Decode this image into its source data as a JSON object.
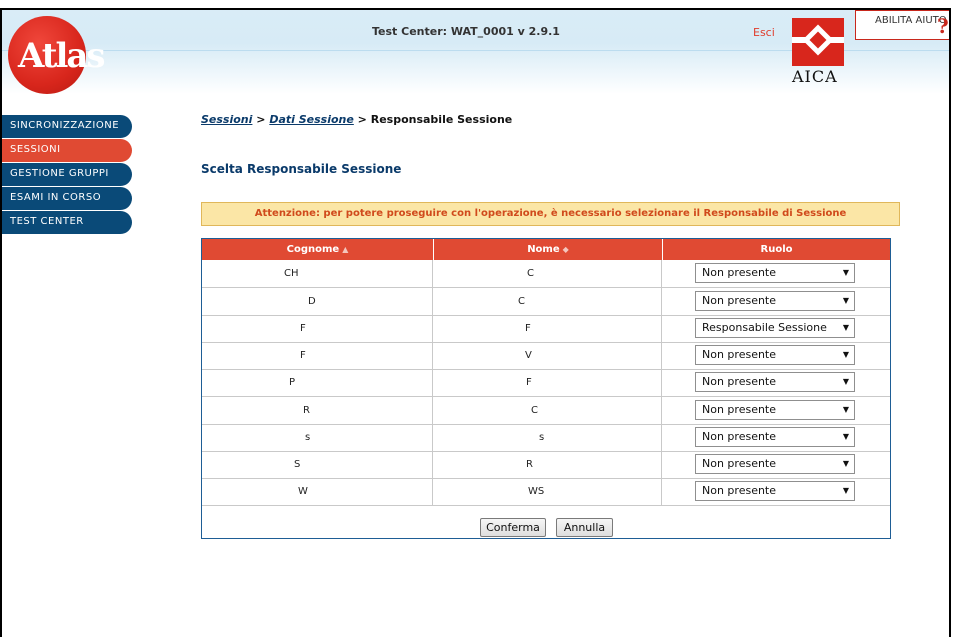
{
  "header": {
    "brand": "Atlas",
    "app_title": "Test Center: WAT_0001 v 2.9.1",
    "exit_label": "Esci",
    "partner_logo_text": "AICA",
    "help_label": "ABILITA AIUTO",
    "help_icon": "?"
  },
  "sidebar": {
    "items": [
      {
        "label": "SINCRONIZZAZIONE",
        "active": false
      },
      {
        "label": "SESSIONI",
        "active": true
      },
      {
        "label": "GESTIONE GRUPPI",
        "active": false
      },
      {
        "label": "ESAMI IN CORSO",
        "active": false
      },
      {
        "label": "TEST CENTER",
        "active": false
      }
    ]
  },
  "breadcrumb": {
    "level1": "Sessioni",
    "sep1": " > ",
    "level2": "Dati Sessione",
    "sep2": " > ",
    "current": "Responsabile Sessione"
  },
  "section_title": "Scelta Responsabile Sessione",
  "warning": "Attenzione: per potere proseguire con l'operazione, è necessario selezionare il Responsabile di Sessione",
  "table": {
    "headers": {
      "cognome": "Cognome",
      "nome": "Nome",
      "ruolo": "Ruolo"
    },
    "sort_icons": {
      "cognome": "▲",
      "nome": "◆"
    },
    "rows": [
      {
        "cognome": "CH",
        "nome": "C",
        "ruolo": "Non presente"
      },
      {
        "cognome": "D",
        "nome": "C",
        "ruolo": "Non presente"
      },
      {
        "cognome": "F",
        "nome": "F",
        "ruolo": "Responsabile Sessione"
      },
      {
        "cognome": "F",
        "nome": "V",
        "ruolo": "Non presente"
      },
      {
        "cognome": "P",
        "nome": "F",
        "ruolo": "Non presente"
      },
      {
        "cognome": "R",
        "nome": "C",
        "ruolo": "Non presente"
      },
      {
        "cognome": "s",
        "nome": "s",
        "ruolo": "Non presente"
      },
      {
        "cognome": "S",
        "nome": "R",
        "ruolo": "Non presente"
      },
      {
        "cognome": "W",
        "nome": "WS",
        "ruolo": "Non presente"
      }
    ]
  },
  "buttons": {
    "confirm": "Conferma",
    "cancel": "Annulla"
  },
  "colors": {
    "accent_red": "#e04a33",
    "nav_blue": "#0a4a78",
    "warning_bg": "#fbe6a6"
  }
}
